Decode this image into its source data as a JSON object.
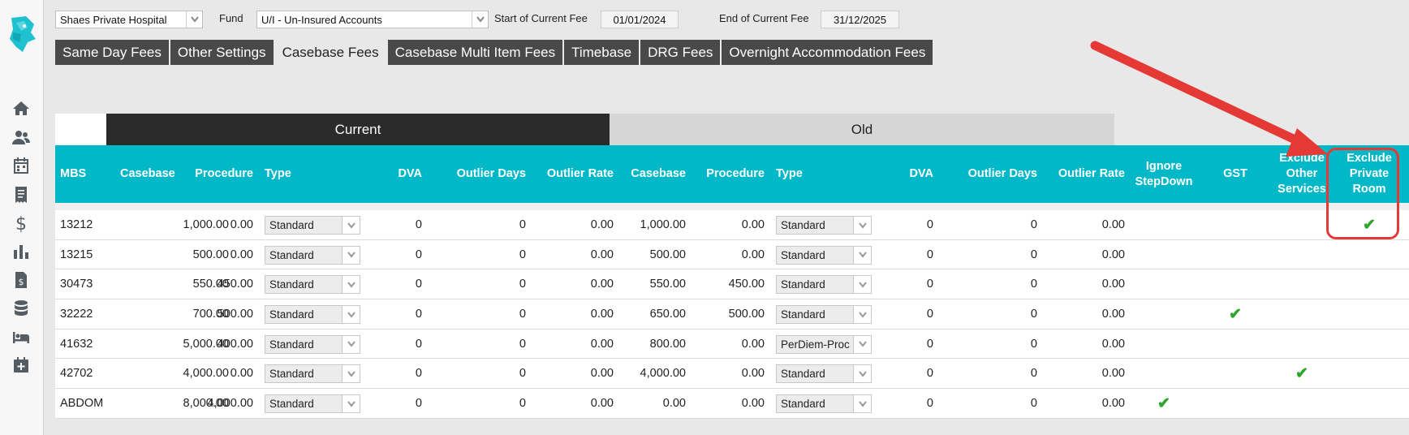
{
  "top_bar": {
    "hospital": "Shaes Private Hospital",
    "fund_label": "Fund",
    "fund": "U/I - Un-Insured Accounts",
    "start_label": "Start of Current Fee",
    "start_date": "01/01/2024",
    "end_label": "End of Current Fee",
    "end_date": "31/12/2025"
  },
  "tabs": [
    {
      "label": "Same Day Fees",
      "active": false
    },
    {
      "label": "Other Settings",
      "active": false
    },
    {
      "label": "Casebase Fees",
      "active": true
    },
    {
      "label": "Casebase Multi Item Fees",
      "active": false
    },
    {
      "label": "Timebase",
      "active": false
    },
    {
      "label": "DRG Fees",
      "active": false
    },
    {
      "label": "Overnight Accommodation Fees",
      "active": false
    }
  ],
  "groups": {
    "current": "Current",
    "old": "Old"
  },
  "columns": {
    "mbs": "MBS",
    "casebase": "Casebase",
    "procedure": "Procedure",
    "type": "Type",
    "dva": "DVA",
    "outlier_days": "Outlier Days",
    "outlier_rate": "Outlier Rate",
    "old_casebase": "Casebase",
    "old_procedure": "Procedure",
    "old_type": "Type",
    "old_dva": "DVA",
    "old_outlier_days": "Outlier Days",
    "old_outlier_rate": "Outlier Rate",
    "ignore_stepdown_1": "Ignore",
    "ignore_stepdown_2": "StepDown",
    "gst": "GST",
    "exclude_other_1": "Exclude",
    "exclude_other_2": "Other",
    "exclude_other_3": "Services",
    "exclude_private_1": "Exclude",
    "exclude_private_2": "Private",
    "exclude_private_3": "Room"
  },
  "rows": [
    {
      "mbs": "13212",
      "casebase": "1,000.00",
      "procedure": "0.00",
      "type": "Standard",
      "dva": "0",
      "outlier_days": "0",
      "outlier_rate": "0.00",
      "old_casebase": "1,000.00",
      "old_procedure": "0.00",
      "old_type": "Standard",
      "old_dva": "0",
      "old_outlier_days": "0",
      "old_outlier_rate": "0.00",
      "ignore_stepdown": false,
      "gst": false,
      "exclude_other": false,
      "exclude_private": true
    },
    {
      "mbs": "13215",
      "casebase": "500.00",
      "procedure": "0.00",
      "type": "Standard",
      "dva": "0",
      "outlier_days": "0",
      "outlier_rate": "0.00",
      "old_casebase": "500.00",
      "old_procedure": "0.00",
      "old_type": "Standard",
      "old_dva": "0",
      "old_outlier_days": "0",
      "old_outlier_rate": "0.00",
      "ignore_stepdown": false,
      "gst": false,
      "exclude_other": false,
      "exclude_private": false
    },
    {
      "mbs": "30473",
      "casebase": "550.00",
      "procedure": "450.00",
      "type": "Standard",
      "dva": "0",
      "outlier_days": "0",
      "outlier_rate": "0.00",
      "old_casebase": "550.00",
      "old_procedure": "450.00",
      "old_type": "Standard",
      "old_dva": "0",
      "old_outlier_days": "0",
      "old_outlier_rate": "0.00",
      "ignore_stepdown": false,
      "gst": false,
      "exclude_other": false,
      "exclude_private": false
    },
    {
      "mbs": "32222",
      "casebase": "700.00",
      "procedure": "500.00",
      "type": "Standard",
      "dva": "0",
      "outlier_days": "0",
      "outlier_rate": "0.00",
      "old_casebase": "650.00",
      "old_procedure": "500.00",
      "old_type": "Standard",
      "old_dva": "0",
      "old_outlier_days": "0",
      "old_outlier_rate": "0.00",
      "ignore_stepdown": false,
      "gst": true,
      "exclude_other": false,
      "exclude_private": false
    },
    {
      "mbs": "41632",
      "casebase": "5,000.00",
      "procedure": "400.00",
      "type": "Standard",
      "dva": "0",
      "outlier_days": "0",
      "outlier_rate": "0.00",
      "old_casebase": "800.00",
      "old_procedure": "0.00",
      "old_type": "PerDiem-Proc",
      "old_dva": "0",
      "old_outlier_days": "0",
      "old_outlier_rate": "0.00",
      "ignore_stepdown": false,
      "gst": false,
      "exclude_other": false,
      "exclude_private": false
    },
    {
      "mbs": "42702",
      "casebase": "4,000.00",
      "procedure": "0.00",
      "type": "Standard",
      "dva": "0",
      "outlier_days": "0",
      "outlier_rate": "0.00",
      "old_casebase": "4,000.00",
      "old_procedure": "0.00",
      "old_type": "Standard",
      "old_dva": "0",
      "old_outlier_days": "0",
      "old_outlier_rate": "0.00",
      "ignore_stepdown": false,
      "gst": false,
      "exclude_other": true,
      "exclude_private": false
    },
    {
      "mbs": "ABDOM",
      "casebase": "8,000.00",
      "procedure": "4,000.00",
      "type": "Standard",
      "dva": "0",
      "outlier_days": "0",
      "outlier_rate": "0.00",
      "old_casebase": "0.00",
      "old_procedure": "0.00",
      "old_type": "Standard",
      "old_dva": "0",
      "old_outlier_days": "0",
      "old_outlier_rate": "0.00",
      "ignore_stepdown": true,
      "gst": false,
      "exclude_other": false,
      "exclude_private": false
    }
  ],
  "icons": [
    "logo-icon",
    "home-icon",
    "people-icon",
    "calendar-icon",
    "receipt-icon",
    "dollar-icon",
    "bar-chart-icon",
    "invoice-icon",
    "database-icon",
    "bed-icon",
    "calendar-plus-icon"
  ],
  "colors": {
    "header": "#00b8c8",
    "tab_dark": "#494949",
    "check": "#2ea52e",
    "annotation": "#e53935"
  }
}
